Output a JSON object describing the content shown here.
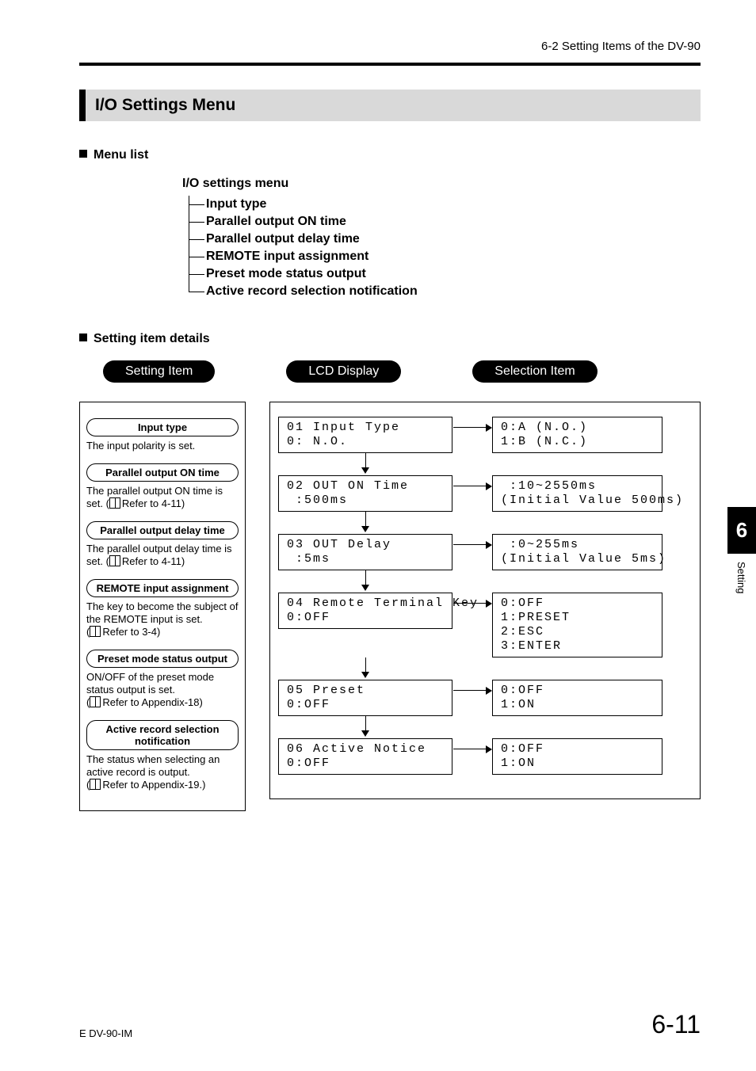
{
  "header": {
    "right": "6-2  Setting Items of the DV-90"
  },
  "section_title": "I/O Settings Menu",
  "sub1": "Menu list",
  "menu": {
    "root": "I/O settings menu",
    "items": [
      "Input type",
      "Parallel output ON time",
      "Parallel output delay time",
      "REMOTE input assignment",
      "Preset mode status output",
      "Active record selection notification"
    ]
  },
  "sub2": "Setting item details",
  "pills": {
    "a": "Setting Item",
    "b": "LCD Display",
    "c": "Selection Item"
  },
  "left_items": [
    {
      "label": "Input type",
      "desc": "The input polarity is set.",
      "ref": ""
    },
    {
      "label": "Parallel output ON time",
      "desc": "The parallel output ON time is set. (",
      "ref": "Refer to 4-11)"
    },
    {
      "label": "Parallel output delay time",
      "desc": "The parallel output delay time is set. (",
      "ref": "Refer to 4-11)"
    },
    {
      "label": "REMOTE input assignment",
      "desc": "The key to become the subject of the REMOTE input is set.\n(",
      "ref": "Refer to 3-4)"
    },
    {
      "label": "Preset mode status output",
      "desc": "ON/OFF of the preset mode status output is set.\n(",
      "ref": "Refer to Appendix-18)"
    },
    {
      "label": "Active record selection notification",
      "desc": "The status when selecting an active record is output.\n(",
      "ref": "Refer to Appendix-19.)"
    }
  ],
  "rows": [
    {
      "lcd": "01 Input Type\n0: N.O.",
      "sel": "0:A (N.O.)\n1:B (N.C.)"
    },
    {
      "lcd": "02 OUT ON Time\n :500ms",
      "sel": " :10~2550ms\n(Initial Value 500ms)"
    },
    {
      "lcd": "03 OUT Delay\n :5ms",
      "sel": " :0~255ms\n(Initial Value 5ms)"
    },
    {
      "lcd": "04 Remote Terminal Key\n0:OFF",
      "sel": "0:OFF\n1:PRESET\n2:ESC\n3:ENTER"
    },
    {
      "lcd": "05 Preset\n0:OFF",
      "sel": "0:OFF\n1:ON"
    },
    {
      "lcd": "06 Active Notice\n0:OFF",
      "sel": "0:OFF\n1:ON"
    }
  ],
  "side": {
    "chapter": "6",
    "label": "Setting"
  },
  "footer": {
    "left": "E DV-90-IM",
    "right": "6-11"
  }
}
